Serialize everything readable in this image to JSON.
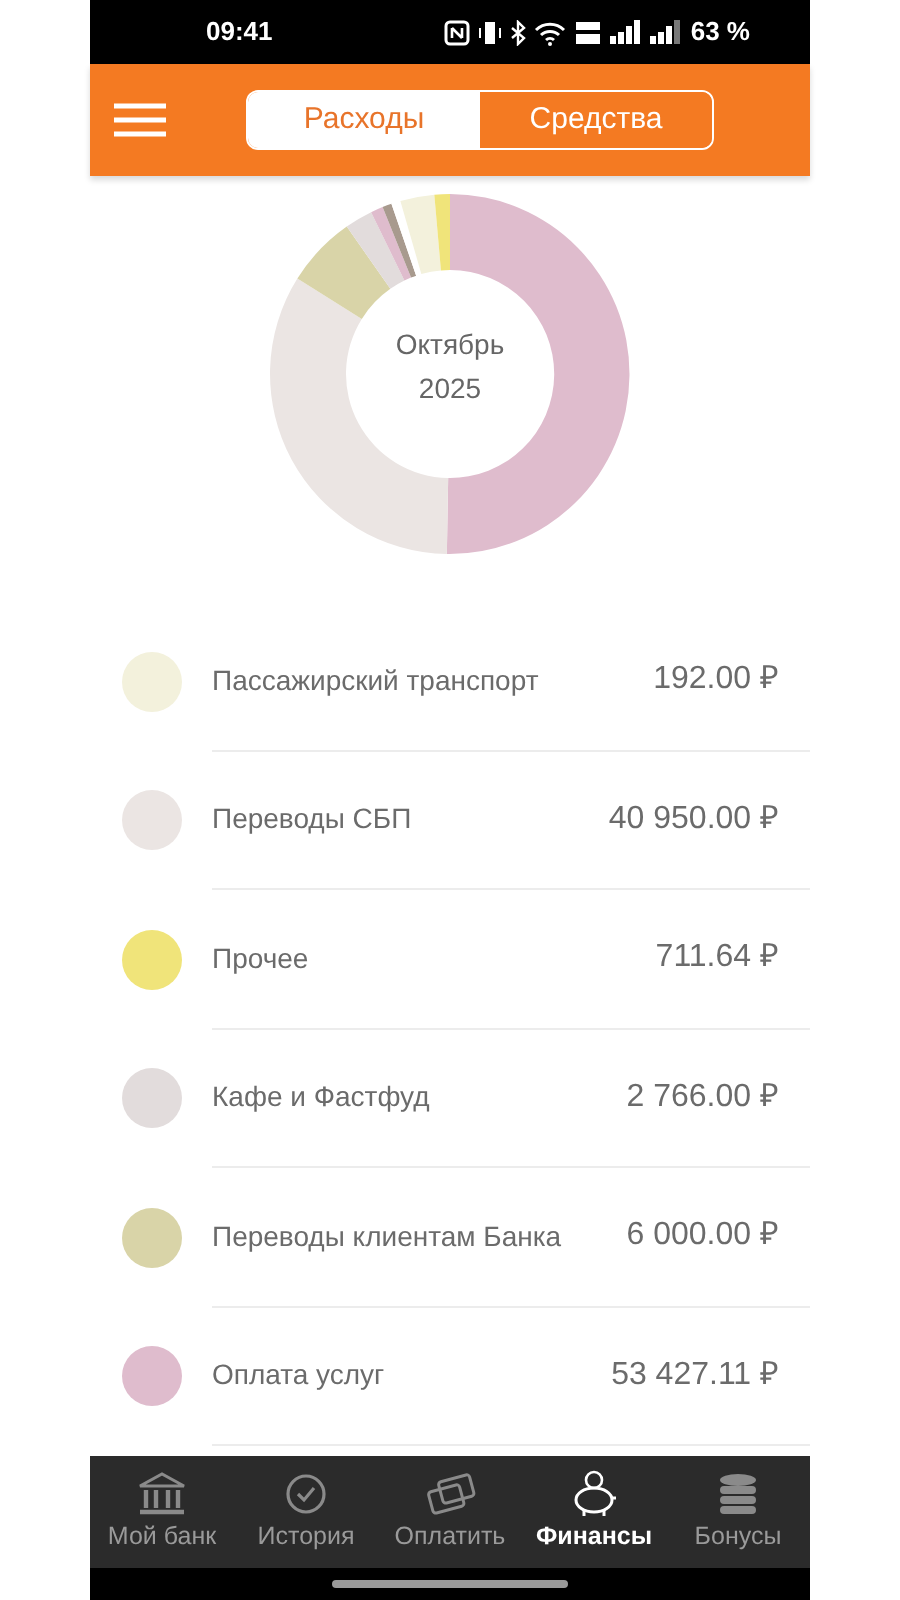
{
  "status_bar": {
    "time": "09:41",
    "battery": "63 %"
  },
  "tabs": [
    {
      "label": "Расходы",
      "selected": true
    },
    {
      "label": "Средства",
      "selected": false
    }
  ],
  "chart_center": {
    "line_1": "Октябрь",
    "line_2": "2025"
  },
  "categories": [
    {
      "name": "Пассажирский транспорт",
      "amount": "192.00 ₽",
      "color": "#f3f1dc"
    },
    {
      "name": "Переводы СБП",
      "amount": "40 950.00 ₽",
      "color": "#ebe5e3"
    },
    {
      "name": "Прочее",
      "amount": "711.64 ₽",
      "color": "#f0e47a"
    },
    {
      "name": "Кафе и Фастфуд",
      "amount": "2 766.00 ₽",
      "color": "#e2dcdc"
    },
    {
      "name": "Переводы клиентам Банка",
      "amount": "6 000.00 ₽",
      "color": "#d9d4a8"
    },
    {
      "name": "Оплата услуг",
      "amount": "53 427.11 ₽",
      "color": "#dfbccd"
    }
  ],
  "bottom_nav": [
    {
      "kind": "bank",
      "label": "Мой банк",
      "selected": false
    },
    {
      "kind": "history",
      "label": "История",
      "selected": false
    },
    {
      "kind": "pay",
      "label": "Оплатить",
      "selected": false
    },
    {
      "kind": "finance",
      "label": "Финансы",
      "selected": true
    },
    {
      "kind": "bonus",
      "label": "Бонусы",
      "selected": false
    }
  ]
}
